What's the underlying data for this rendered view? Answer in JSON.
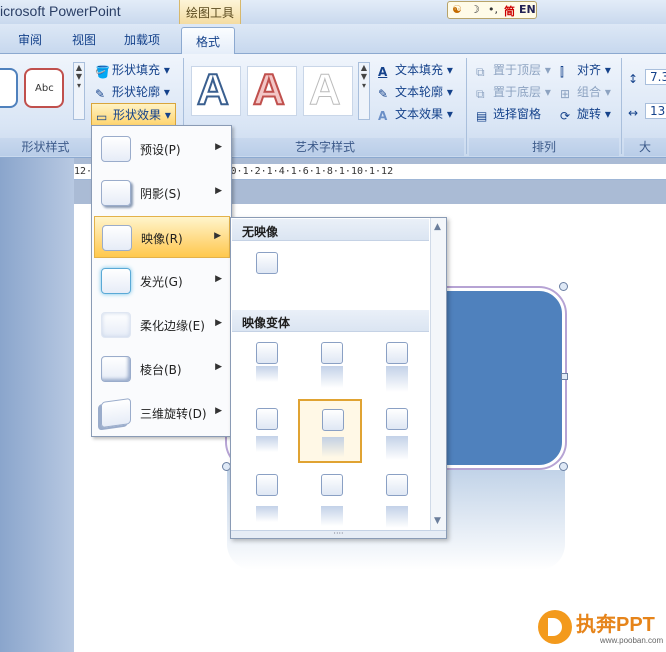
{
  "window": {
    "app_title": "icrosoft PowerPoint",
    "context_tool": "绘图工具"
  },
  "ime": {
    "simplified": "简",
    "lang": "EN"
  },
  "tabs": [
    {
      "label": "审阅"
    },
    {
      "label": "视图"
    },
    {
      "label": "加载项"
    },
    {
      "label": "格式",
      "active": true
    }
  ],
  "ribbon": {
    "shape_styles": {
      "sample_text": "Abc",
      "fill": "形状填充",
      "outline": "形状轮廓",
      "effects": "形状效果",
      "label": "形状样式"
    },
    "wordart": {
      "glyph": "A",
      "text_fill": "文本填充",
      "text_outline": "文本轮廓",
      "text_effects": "文本效果",
      "label": "艺术字样式"
    },
    "arrange": {
      "bring_front": "置于顶层",
      "align": "对齐",
      "send_back": "置于底层",
      "group": "组合",
      "selection_pane": "选择窗格",
      "rotate": "旋转",
      "label": "排列"
    },
    "size": {
      "height": "7.3",
      "width": "13",
      "label": "大"
    }
  },
  "ruler": {
    "text": "12·1·10·1·8·1·6·1·4·1·2·1·0·1·2·1·4·1·6·1·8·1·10·1·12"
  },
  "effects_menu": {
    "items": [
      {
        "label": "预设(P)"
      },
      {
        "label": "阴影(S)"
      },
      {
        "label": "映像(R)",
        "highlighted": true
      },
      {
        "label": "发光(G)"
      },
      {
        "label": "柔化边缘(E)"
      },
      {
        "label": "棱台(B)"
      },
      {
        "label": "三维旋转(D)"
      }
    ]
  },
  "reflection_gallery": {
    "no_reflection_header": "无映像",
    "variants_header": "映像变体",
    "selected_index": 4
  },
  "watermark": {
    "name": "执奔PPT",
    "site": "www.pooban.com"
  },
  "colors": {
    "accent": "#4f81bd",
    "highlight": "#ffd980"
  }
}
